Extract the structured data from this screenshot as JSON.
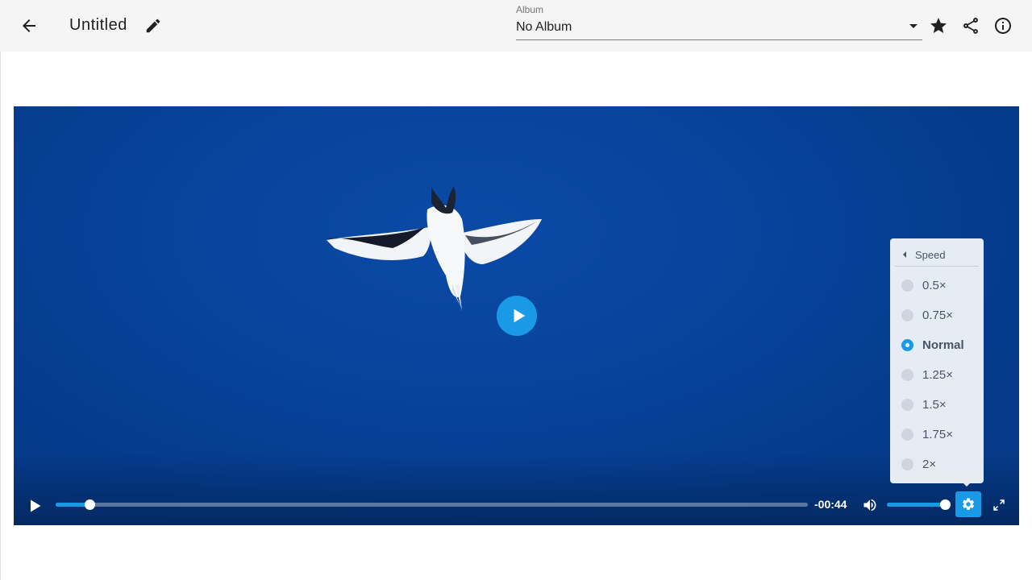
{
  "header": {
    "title": "Untitled",
    "album_label": "Album",
    "album_value": "No Album",
    "icons": [
      "arrow-back-icon",
      "pencil-icon",
      "star-icon",
      "share-icon",
      "info-icon"
    ]
  },
  "player": {
    "time_remaining": "-00:44",
    "progress_percent": 4.5,
    "volume_percent": 100,
    "accent_color": "#1a9ae6",
    "speed_menu": {
      "title": "Speed",
      "options": [
        "0.5×",
        "0.75×",
        "Normal",
        "1.25×",
        "1.5×",
        "1.75×",
        "2×"
      ],
      "selected": "Normal"
    }
  }
}
